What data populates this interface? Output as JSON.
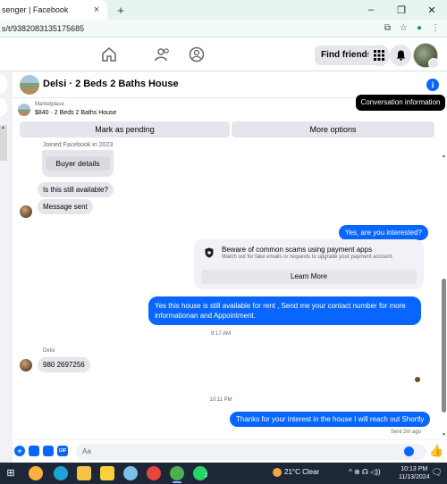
{
  "browser": {
    "tab_title": "senger | Facebook",
    "tab_close": "×",
    "new_tab": "+",
    "window_controls": [
      "–",
      "❐",
      "✕"
    ],
    "url": "s/t/9382083135175685"
  },
  "fb_nav": {
    "find_friends": "Find friends",
    "icons": [
      "home-icon",
      "friends-icon",
      "groups-icon",
      "menu-grid-icon",
      "bell-icon",
      "profile-avatar"
    ]
  },
  "chat": {
    "title": "Delsi · 2 Beds 2 Baths House",
    "tooltip": "Conversation information",
    "marketplace_label": "Marketplace",
    "listing_price": "$840 · 2 Beds 2 Baths House",
    "mark_pending": "Mark as pending",
    "more_options": "More options",
    "joined": "Joined Facebook in 2023",
    "buyer_details": "Buyer details",
    "messages": {
      "m1": "Is this still available?",
      "m2": "Message sent",
      "m3": "Yes, are you interested?",
      "m4_line1": "Yes this house is still available for rent , Send me your contact number for more",
      "m4_line2": "informationan and Appointment.",
      "time1": "9:17 AM",
      "sender_name": "Delsi",
      "m5": "980 2697256",
      "time2": "10:11 PM",
      "m6": "Thanks for your interest in the house I will reach out Shortly",
      "sent_status": "Sent 2m ago"
    },
    "scam_card": {
      "title": "Beware of common scams using payment apps",
      "subtitle": "Watch out for fake emails or requests to upgrade your payment account.",
      "learn_more": "Learn More"
    },
    "composer_placeholder": "Aa"
  },
  "taskbar": {
    "weather": "21°C  Clear",
    "tray": "^  ⊕  ☊  ◁))",
    "time": "10:13 PM",
    "date": "11/13/2024",
    "whatsapp_badge": "2"
  },
  "colors": {
    "accent": "#0866ff",
    "bubble_in": "#e4e6eb",
    "taskbar": "#1d2738"
  }
}
